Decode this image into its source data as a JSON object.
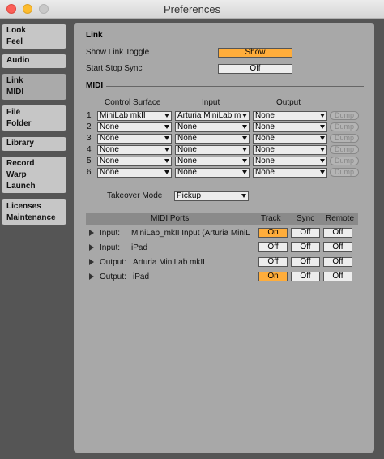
{
  "window": {
    "title": "Preferences"
  },
  "sidebar": {
    "tabs": [
      {
        "lines": [
          "Look",
          "Feel"
        ]
      },
      {
        "lines": [
          "Audio"
        ]
      },
      {
        "lines": [
          "Link",
          "MIDI"
        ]
      },
      {
        "lines": [
          "File",
          "Folder"
        ]
      },
      {
        "lines": [
          "Library"
        ]
      },
      {
        "lines": [
          "Record",
          "Warp",
          "Launch"
        ]
      },
      {
        "lines": [
          "Licenses",
          "Maintenance"
        ]
      }
    ]
  },
  "link": {
    "heading": "Link",
    "show_link_toggle_label": "Show Link Toggle",
    "show_link_toggle_value": "Show",
    "start_stop_sync_label": "Start Stop Sync",
    "start_stop_sync_value": "Off"
  },
  "midi": {
    "heading": "MIDI",
    "col_control_surface": "Control Surface",
    "col_input": "Input",
    "col_output": "Output",
    "dump_label": "Dump",
    "rows": [
      {
        "num": "1",
        "surface": "MiniLab mkII",
        "input": "Arturia MiniLab mkII",
        "output": "None"
      },
      {
        "num": "2",
        "surface": "None",
        "input": "None",
        "output": "None"
      },
      {
        "num": "3",
        "surface": "None",
        "input": "None",
        "output": "None"
      },
      {
        "num": "4",
        "surface": "None",
        "input": "None",
        "output": "None"
      },
      {
        "num": "5",
        "surface": "None",
        "input": "None",
        "output": "None"
      },
      {
        "num": "6",
        "surface": "None",
        "input": "None",
        "output": "None"
      }
    ],
    "takeover_label": "Takeover Mode",
    "takeover_value": "Pickup"
  },
  "ports": {
    "header": {
      "ports": "MIDI Ports",
      "track": "Track",
      "sync": "Sync",
      "remote": "Remote"
    },
    "rows": [
      {
        "dir": "Input:",
        "name": "MiniLab_mkII Input (Arturia MiniL",
        "track": "On",
        "sync": "Off",
        "remote": "Off"
      },
      {
        "dir": "Input:",
        "name": "iPad",
        "track": "Off",
        "sync": "Off",
        "remote": "Off"
      },
      {
        "dir": "Output:",
        "name": "Arturia MiniLab mkII",
        "track": "Off",
        "sync": "Off",
        "remote": "Off"
      },
      {
        "dir": "Output:",
        "name": "iPad",
        "track": "On",
        "sync": "Off",
        "remote": "Off"
      }
    ]
  },
  "colors": {
    "accent_on": "#ffad3b",
    "panel": "#a8a8a8",
    "window": "#555555"
  }
}
